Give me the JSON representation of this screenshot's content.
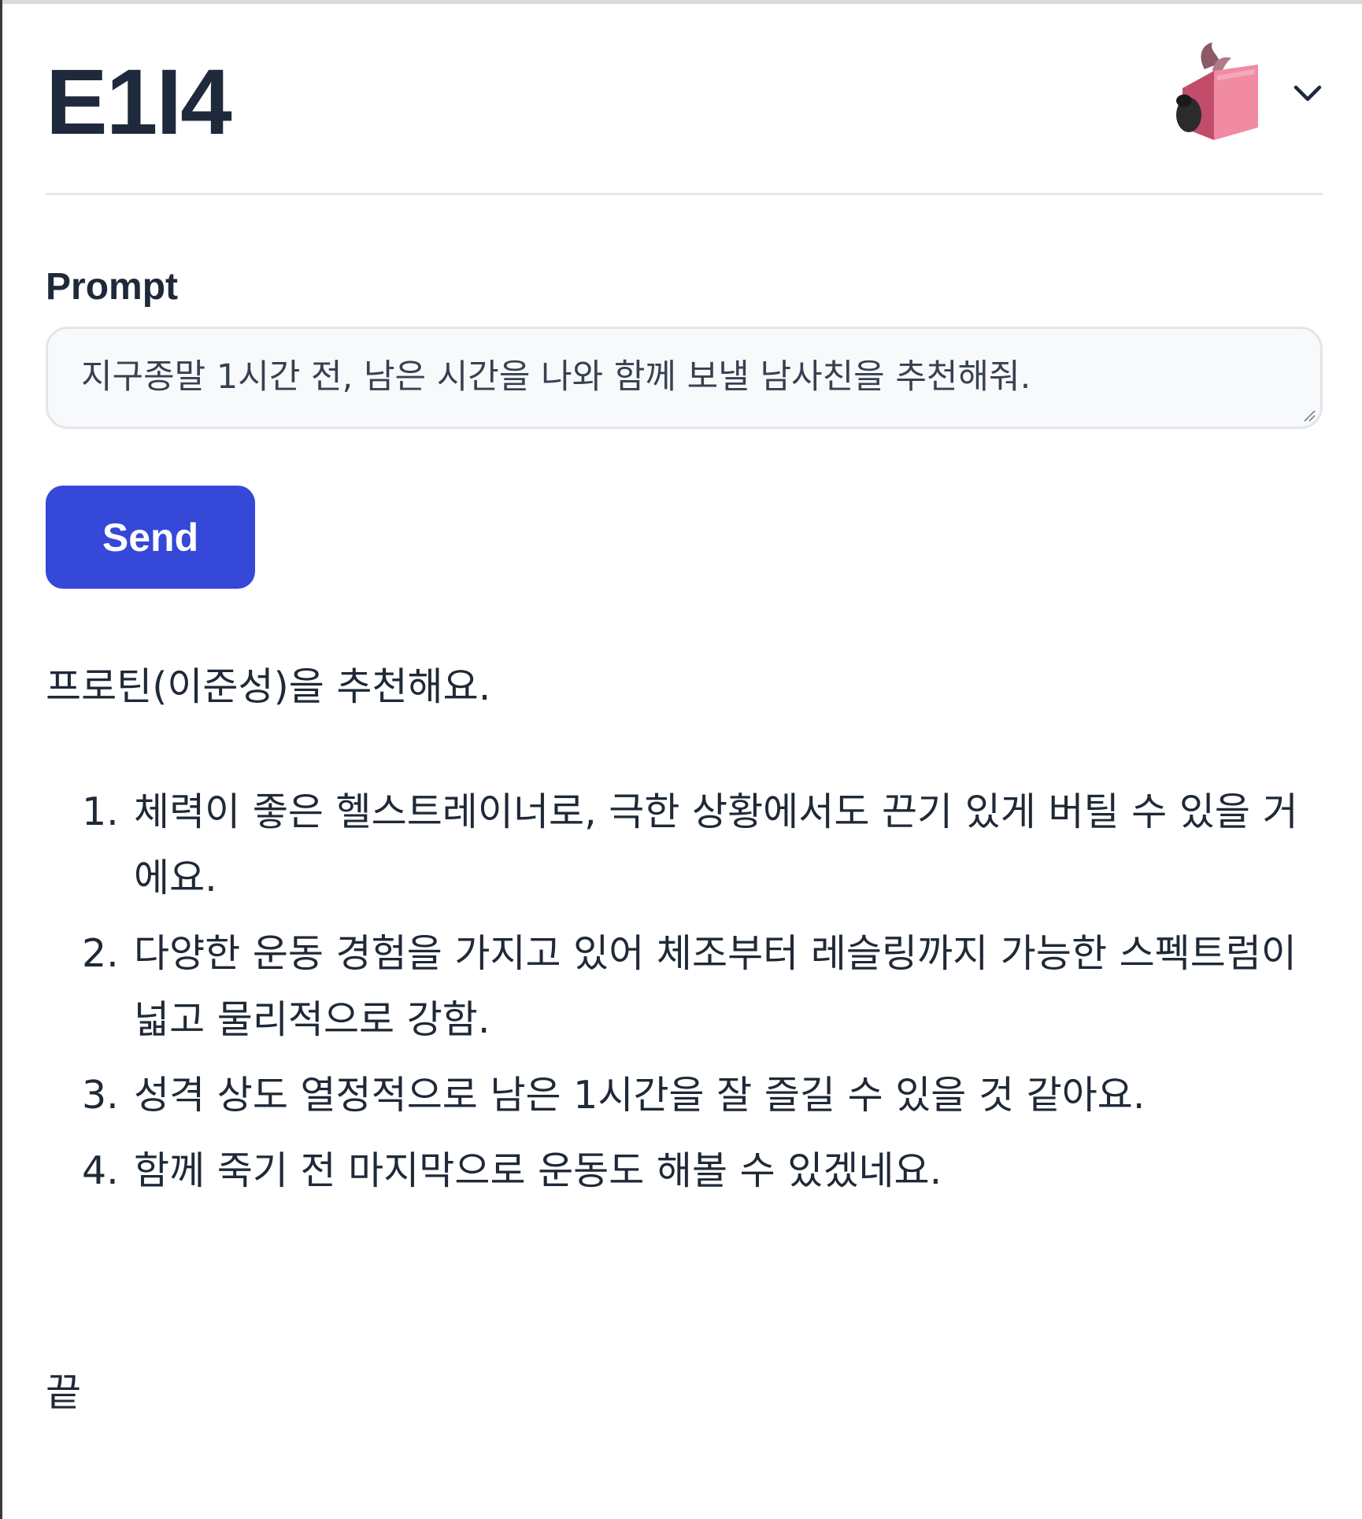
{
  "header": {
    "title": "E1I4"
  },
  "prompt": {
    "label": "Prompt",
    "value": "지구종말 1시간 전, 남은 시간을 나와 함께 보낼 남사친을 추천해줘."
  },
  "send_button": {
    "label": "Send"
  },
  "answer": {
    "intro": "프로틴(이준성)을 추천해요.",
    "items": [
      {
        "num": "1.",
        "text": "체력이 좋은 헬스트레이너로, 극한 상황에서도 끈기 있게 버틸 수 있을 거에요."
      },
      {
        "num": "2.",
        "text": "다양한 운동 경험을 가지고 있어 체조부터 레슬링까지 가능한 스펙트럼이 넓고 물리적으로 강함."
      },
      {
        "num": "3.",
        "text": "성격 상도 열정적으로 남은 1시간을 잘 즐길 수 있을 것 같아요."
      },
      {
        "num": "4.",
        "text": "함께 죽기 전 마지막으로 운동도 해볼 수 있겠네요."
      }
    ],
    "end": "끝"
  },
  "icons": {
    "avatar": "reading-book-avatar-icon",
    "menu": "chevron-down-icon"
  },
  "colors": {
    "accent": "#3548d8",
    "title": "#1e293b",
    "input_bg": "#f8f9fb",
    "divider": "#e5e7eb"
  }
}
